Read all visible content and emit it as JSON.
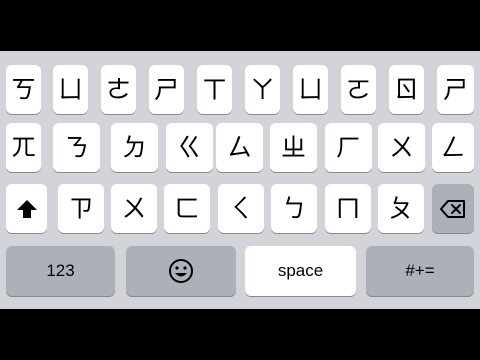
{
  "keyboard": {
    "rows": [
      [
        "ㄎ",
        "ㄩ",
        "ㄜ",
        "ㄕ",
        "ㄒ",
        "ㄚ",
        "ㄩ",
        "ㄛ",
        "ㄖ",
        "ㄕ"
      ],
      [
        "ㄫ",
        "ㄋ",
        "ㄉ",
        "ㄍ",
        "ㄙ",
        "ㄓ",
        "ㄏ",
        "ㄨ",
        "ㄥ"
      ],
      [
        "ㄗ",
        "ㄨ",
        "ㄈ",
        "ㄑ",
        "ㄅ",
        "ㄇ",
        "ㄆ"
      ]
    ],
    "bottom": {
      "numbers_label": "123",
      "space_label": "space",
      "symbols_label": "#+="
    },
    "icons": {
      "shift": "shift-arrow-icon",
      "backspace": "backspace-icon",
      "emoji": "emoji-icon"
    }
  }
}
